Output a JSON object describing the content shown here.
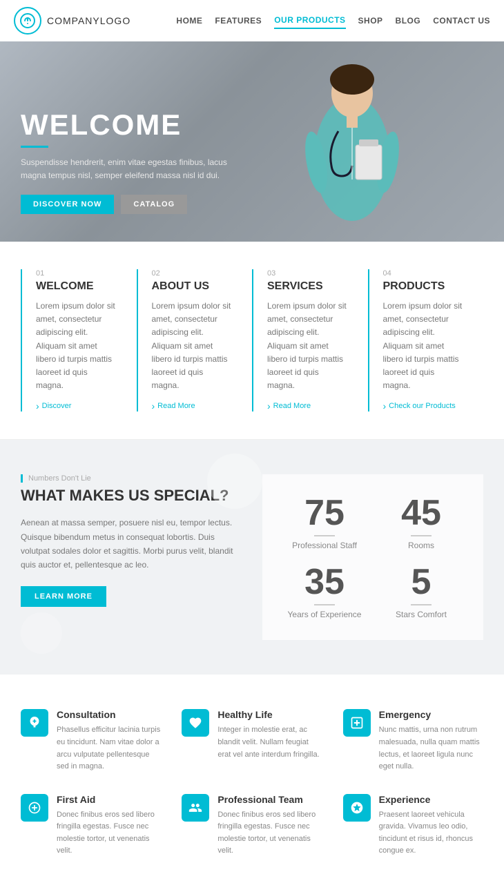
{
  "header": {
    "logo_icon": "⊕",
    "logo_text_bold": "COMPANY",
    "logo_text_normal": "LOGO",
    "nav_items": [
      {
        "label": "HOME",
        "active": false
      },
      {
        "label": "FEATURES",
        "active": false
      },
      {
        "label": "OUR PRODUCTS",
        "active": true
      },
      {
        "label": "SHOP",
        "active": false
      },
      {
        "label": "BLOG",
        "active": false
      },
      {
        "label": "CONTACT US",
        "active": false
      }
    ]
  },
  "hero": {
    "title": "WELCOME",
    "description": "Suspendisse hendrerit, enim vitae egestas finibus, lacus magna tempus nisl, semper eleifend massa nisl id dui.",
    "btn_primary": "DISCOVER NOW",
    "btn_secondary": "CATALOG"
  },
  "features": [
    {
      "num": "01",
      "title": "WELCOME",
      "text": "Lorem ipsum dolor sit amet, consectetur adipiscing elit. Aliquam sit amet libero id turpis mattis laoreet id quis magna.",
      "link": "Discover"
    },
    {
      "num": "02",
      "title": "ABOUT US",
      "text": "Lorem ipsum dolor sit amet, consectetur adipiscing elit. Aliquam sit amet libero id turpis mattis laoreet id quis magna.",
      "link": "Read More"
    },
    {
      "num": "03",
      "title": "SERVICES",
      "text": "Lorem ipsum dolor sit amet, consectetur adipiscing elit. Aliquam sit amet libero id turpis mattis laoreet id quis magna.",
      "link": "Read More"
    },
    {
      "num": "04",
      "title": "PRODUCTS",
      "text": "Lorem ipsum dolor sit amet, consectetur adipiscing elit. Aliquam sit amet libero id turpis mattis laoreet id quis magna.",
      "link": "Check our Products"
    }
  ],
  "stats": {
    "label": "Numbers Don't Lie",
    "title": "WHAT MAKES US SPECIAL?",
    "text": "Aenean at massa semper, posuere nisl eu, tempor lectus. Quisque bibendum metus in consequat lobortis. Duis volutpat sodales dolor et sagittis. Morbi purus velit, blandit quis auctor et, pellentesque ac leo.",
    "btn_label": "LEARN MORE",
    "numbers": [
      {
        "value": "75",
        "label": "Professional Staff"
      },
      {
        "value": "45",
        "label": "Rooms"
      },
      {
        "value": "35",
        "label": "Years of Experience"
      },
      {
        "value": "5",
        "label": "Stars Comfort"
      }
    ]
  },
  "services": [
    {
      "icon": "🔬",
      "title": "Consultation",
      "text": "Phasellus efficitur lacinia turpis eu tincidunt. Nam vitae dolor a arcu vulputate pellentesque sed in magna."
    },
    {
      "icon": "♥",
      "title": "Healthy Life",
      "text": "Integer in molestie erat, ac blandit velit. Nullam feugiat erat vel ante interdum fringilla."
    },
    {
      "icon": "🏥",
      "title": "Emergency",
      "text": "Nunc mattis, urna non rutrum malesuada, nulla quam mattis lectus, et laoreet ligula nunc eget nulla."
    },
    {
      "icon": "⚙",
      "title": "First Aid",
      "text": "Donec finibus eros sed libero fringilla egestas. Fusce nec molestie tortor, ut venenatis velit."
    },
    {
      "icon": "👤",
      "title": "Professional Team",
      "text": "Donec finibus eros sed libero fringilla egestas. Fusce nec molestie tortor, ut venenatis velit."
    },
    {
      "icon": "⏳",
      "title": "Experience",
      "text": "Praesent laoreet vehicula gravida. Vivamus leo odio, tincidunt et risus id, rhoncus congue ex."
    }
  ]
}
